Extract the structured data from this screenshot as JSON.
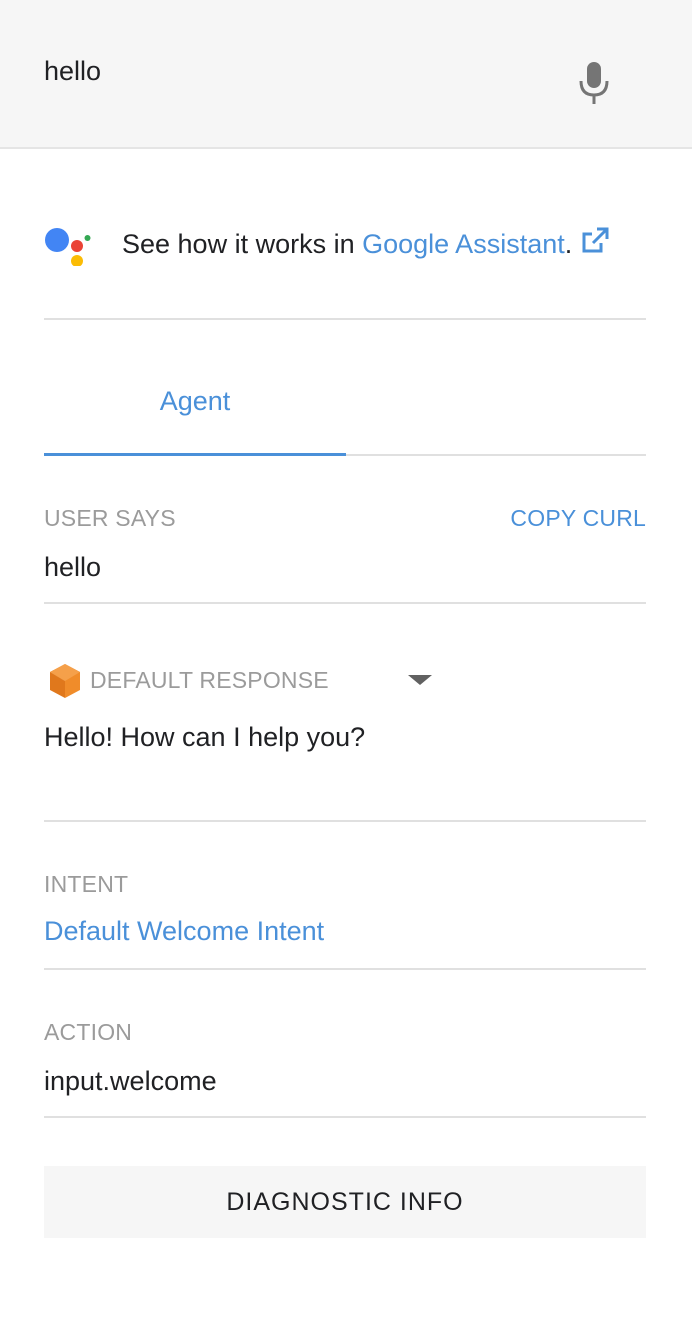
{
  "query": {
    "value": "hello"
  },
  "icons": {
    "mic": "microphone-icon",
    "assistant": "google-assistant-logo",
    "external": "external-link-icon",
    "response": "dialogflow-response-icon",
    "dropdown": "caret-down-icon"
  },
  "colors": {
    "accent": "#4a90d9",
    "label": "#9b9b9b",
    "topbar_bg": "#f6f6f6"
  },
  "assistant": {
    "text_prefix": "See how it works in ",
    "link_text": "Google Assistant",
    "suffix": "."
  },
  "tabs": [
    {
      "label": "Agent",
      "active": true
    }
  ],
  "user_says": {
    "label": "USER SAYS",
    "copy_label": "COPY CURL",
    "value": "hello"
  },
  "response": {
    "label": "DEFAULT RESPONSE",
    "value": "Hello! How can I help you?"
  },
  "intent": {
    "label": "INTENT",
    "value": "Default Welcome Intent"
  },
  "action": {
    "label": "ACTION",
    "value": "input.welcome"
  },
  "diagnostic": {
    "label": "DIAGNOSTIC INFO"
  }
}
